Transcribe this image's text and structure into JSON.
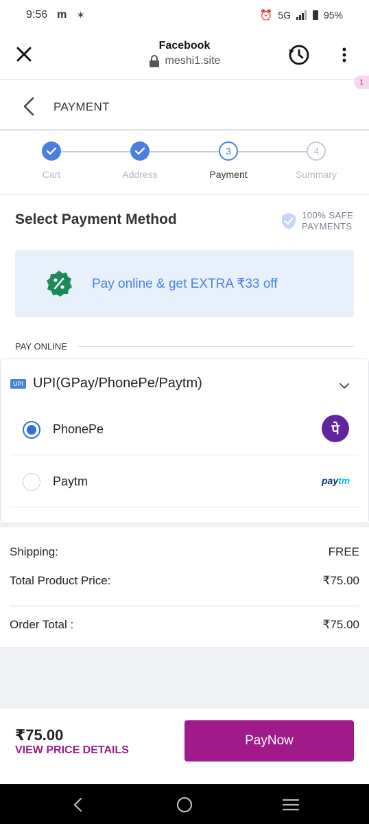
{
  "status_bar": {
    "time": "9:56",
    "app_glyph": "m",
    "extra_glyph": "✶",
    "network": "5G",
    "battery": "95%"
  },
  "browser": {
    "title": "Facebook",
    "url": "meshi1.site",
    "badge": "1"
  },
  "header": {
    "title": "PAYMENT"
  },
  "stepper": {
    "steps": [
      {
        "label": "Cart",
        "state": "done",
        "number": ""
      },
      {
        "label": "Address",
        "state": "done",
        "number": ""
      },
      {
        "label": "Payment",
        "state": "active",
        "number": "3"
      },
      {
        "label": "Summary",
        "state": "todo",
        "number": "4"
      }
    ]
  },
  "payment_section": {
    "title": "Select Payment Method",
    "safe_line1": "100% SAFE",
    "safe_line2": "PAYMENTS",
    "offer_text": "Pay online & get EXTRA ₹33 off",
    "pay_online_label": "PAY ONLINE"
  },
  "upi": {
    "tag": "UPI",
    "title": "UPI(GPay/PhonePe/Paytm)",
    "options": [
      {
        "label": "PhonePe",
        "selected": true,
        "logo_text": "पे"
      },
      {
        "label": "Paytm",
        "selected": false,
        "logo_pay": "pay",
        "logo_tm": "tm"
      }
    ]
  },
  "summary": {
    "shipping_label": "Shipping:",
    "shipping_value": "FREE",
    "product_label": "Total Product Price:",
    "product_value": "₹75.00",
    "order_label": "Order Total :",
    "order_value": "₹75.00"
  },
  "bottom": {
    "price": "₹75.00",
    "details_label": "VIEW PRICE DETAILS",
    "pay_label": "PayNow"
  },
  "colors": {
    "accent_blue": "#4a7fe0",
    "brand_purple": "#a11a8a",
    "phonepe": "#5f259f"
  }
}
